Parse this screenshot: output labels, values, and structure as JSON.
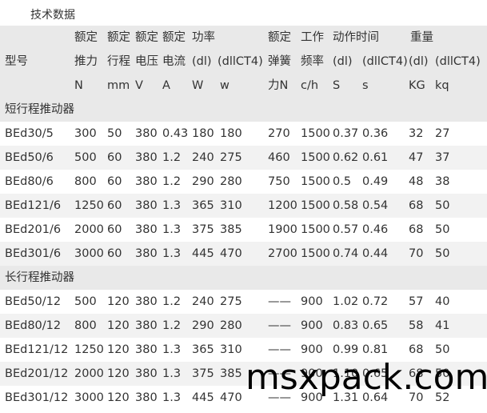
{
  "title": "技术数据",
  "header": {
    "row1": [
      "额定",
      "额定",
      "额定",
      "额定",
      "功率",
      "额定",
      "工作",
      "动作时间",
      "重量"
    ],
    "row2": [
      "型号",
      "推力",
      "行程",
      "电压",
      "电流",
      "(dl)",
      "(dllCT4)",
      "弹簧",
      "频率",
      "(dl)",
      "(dllCT4)",
      "(dl)",
      "(dllCT4)"
    ],
    "row3": [
      "N",
      "mm",
      "V",
      "A",
      "W",
      "w",
      "力N",
      "c/h",
      "S",
      "s",
      "KG",
      "kq"
    ]
  },
  "sections": [
    {
      "label": "短行程推动器",
      "rows": [
        [
          "BEd30/5",
          "300",
          "50",
          "380",
          "0.43",
          "180",
          "180",
          "270",
          "1500",
          "0.37",
          "0.36",
          "32",
          "27"
        ],
        [
          "BEd50/6",
          "500",
          "60",
          "380",
          "1.2",
          "240",
          "275",
          "460",
          "1500",
          "0.62",
          "0.61",
          "47",
          "37"
        ],
        [
          "BEd80/6",
          "800",
          "60",
          "380",
          "1.2",
          "290",
          "280",
          "750",
          "1500",
          "0.5",
          "0.49",
          "48",
          "38"
        ],
        [
          "BEd121/6",
          "1250",
          "60",
          "380",
          "1.3",
          "365",
          "310",
          "1200",
          "1500",
          "0.58",
          "0.54",
          "68",
          "50"
        ],
        [
          "BEd201/6",
          "2000",
          "60",
          "380",
          "1.3",
          "375",
          "385",
          "1900",
          "1500",
          "0.57",
          "0.46",
          "68",
          "50"
        ],
        [
          "BEd301/6",
          "3000",
          "60",
          "380",
          "1.3",
          "445",
          "470",
          "2700",
          "1500",
          "0.74",
          "0.44",
          "70",
          "50"
        ]
      ]
    },
    {
      "label": "长行程推动器",
      "rows": [
        [
          "BEd50/12",
          "500",
          "120",
          "380",
          "1.2",
          "240",
          "275",
          "——",
          "900",
          "1.02",
          "0.72",
          "57",
          "40"
        ],
        [
          "BEd80/12",
          "800",
          "120",
          "380",
          "1.2",
          "290",
          "280",
          "——",
          "900",
          "0.83",
          "0.65",
          "58",
          "41"
        ],
        [
          "BEd121/12",
          "1250",
          "120",
          "380",
          "1.3",
          "365",
          "310",
          "——",
          "900",
          "0.99",
          "0.81",
          "68",
          "50"
        ],
        [
          "BEd201/12",
          "2000",
          "120",
          "380",
          "1.3",
          "375",
          "385",
          "——",
          "900",
          "1.10",
          "0.65",
          "68",
          "50"
        ],
        [
          "BEd301/12",
          "3000",
          "120",
          "380",
          "1.3",
          "445",
          "470",
          "——",
          "900",
          "1.31",
          "0.64",
          "70",
          "52"
        ]
      ]
    }
  ],
  "watermark": "msxpack.com"
}
